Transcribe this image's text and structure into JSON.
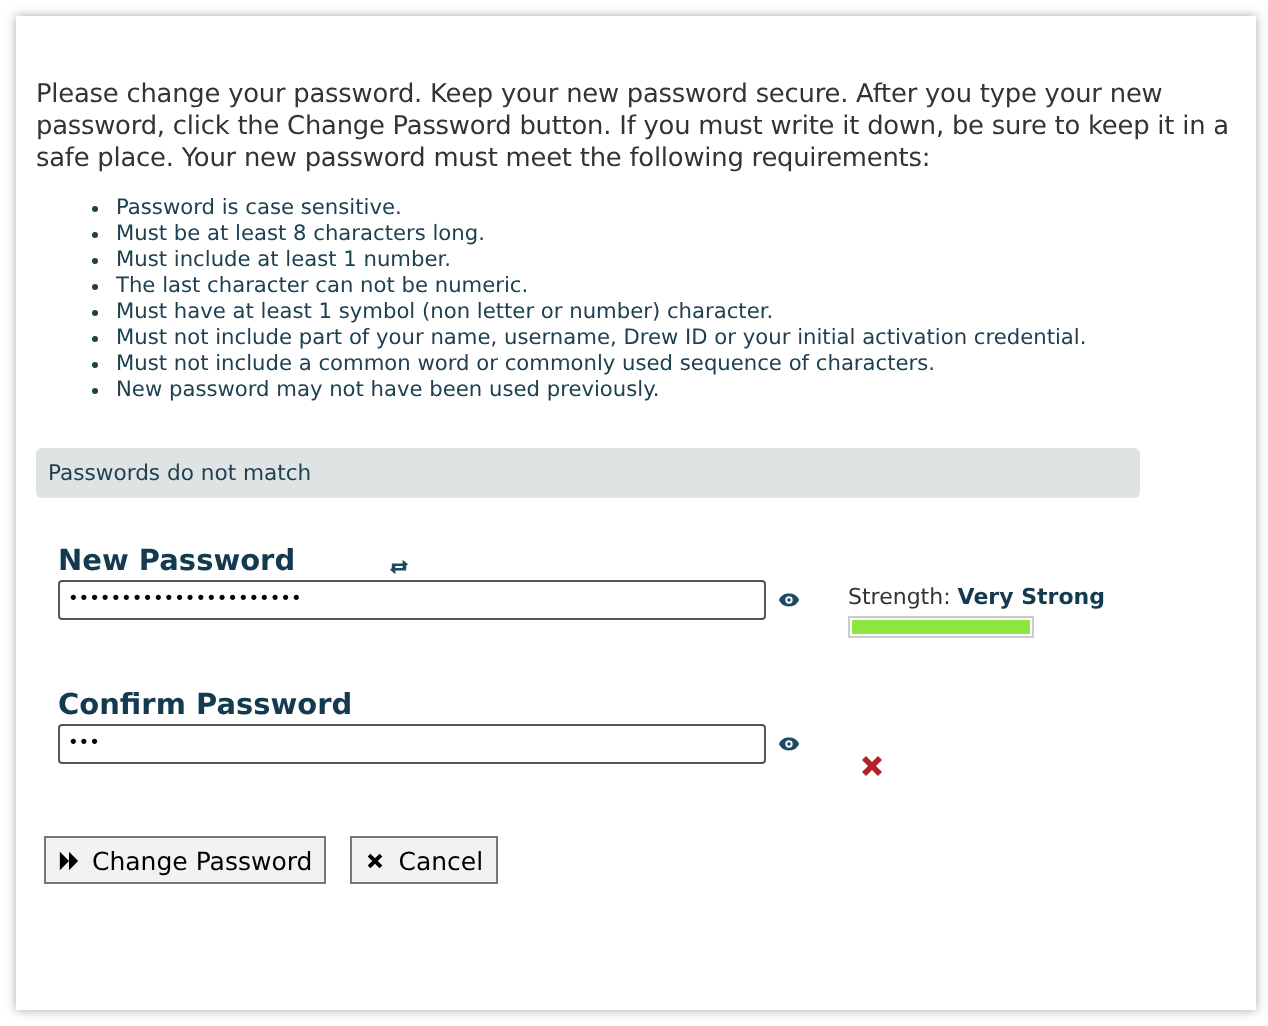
{
  "intro": "Please change your password. Keep your new password secure. After you type your new password, click the Change Password button. If you must write it down, be sure to keep it in a safe place. Your new password must meet the following requirements:",
  "requirements": [
    "Password is case sensitive.",
    "Must be at least 8 characters long.",
    "Must include at least 1 number.",
    "The last character can not be numeric.",
    "Must have at least 1 symbol (non letter or number) character.",
    "Must not include part of your name, username, Drew ID or your initial activation credential.",
    "Must not include a common word or commonly used sequence of characters.",
    "New password may not have been used previously."
  ],
  "message": "Passwords do not match",
  "new_password": {
    "label": "New Password",
    "value": "••••••••••••••••••••••",
    "strength_label": "Strength:",
    "strength": "Very Strong",
    "level": 1
  },
  "confirm_password": {
    "label": "Confirm Password",
    "value": "•••",
    "match": false
  },
  "buttons": [
    {
      "kind": "submit",
      "label": "Change Password"
    },
    {
      "kind": "cancel",
      "label": "Cancel"
    }
  ]
}
